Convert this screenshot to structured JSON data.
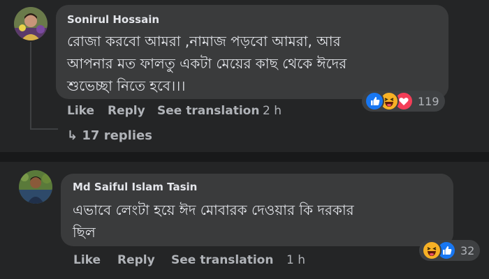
{
  "comments": [
    {
      "author": "Sonirul Hossain",
      "text_lines": [
        "রোজা করবো আমরা ,নামাজ পড়বো আমরা, আর",
        "আপনার মত ফালতু একটা মেয়ের কাছ থেকে ঈদের",
        "শুভেচ্ছা নিতে হবে।।।"
      ],
      "actions": {
        "like": "Like",
        "reply": "Reply",
        "translate": "See translation",
        "time": "2 h"
      },
      "reactions": {
        "icons": [
          "like-icon",
          "haha-icon",
          "love-icon"
        ],
        "count": "119"
      },
      "replies": {
        "arrow": "↳",
        "label": "17 replies"
      }
    },
    {
      "author": "Md Saiful Islam Tasin",
      "text_lines": [
        "এভাবে লেংটা হয়ে ঈদ মোবারক দেওয়ার কি দরকার",
        "ছিল"
      ],
      "actions": {
        "like": "Like",
        "reply": "Reply",
        "translate": "See translation",
        "time": "1 h"
      },
      "reactions": {
        "icons": [
          "haha-icon",
          "like-icon"
        ],
        "count": "32"
      }
    }
  ],
  "colors": {
    "background": "#18191a",
    "panel": "#242526",
    "bubble": "#3a3b3c",
    "text_primary": "#e4e6eb",
    "text_secondary": "#b0b3b8",
    "like_blue": "#1877f2",
    "love_red": "#f33e58",
    "haha_yellow": "#f7b125"
  }
}
